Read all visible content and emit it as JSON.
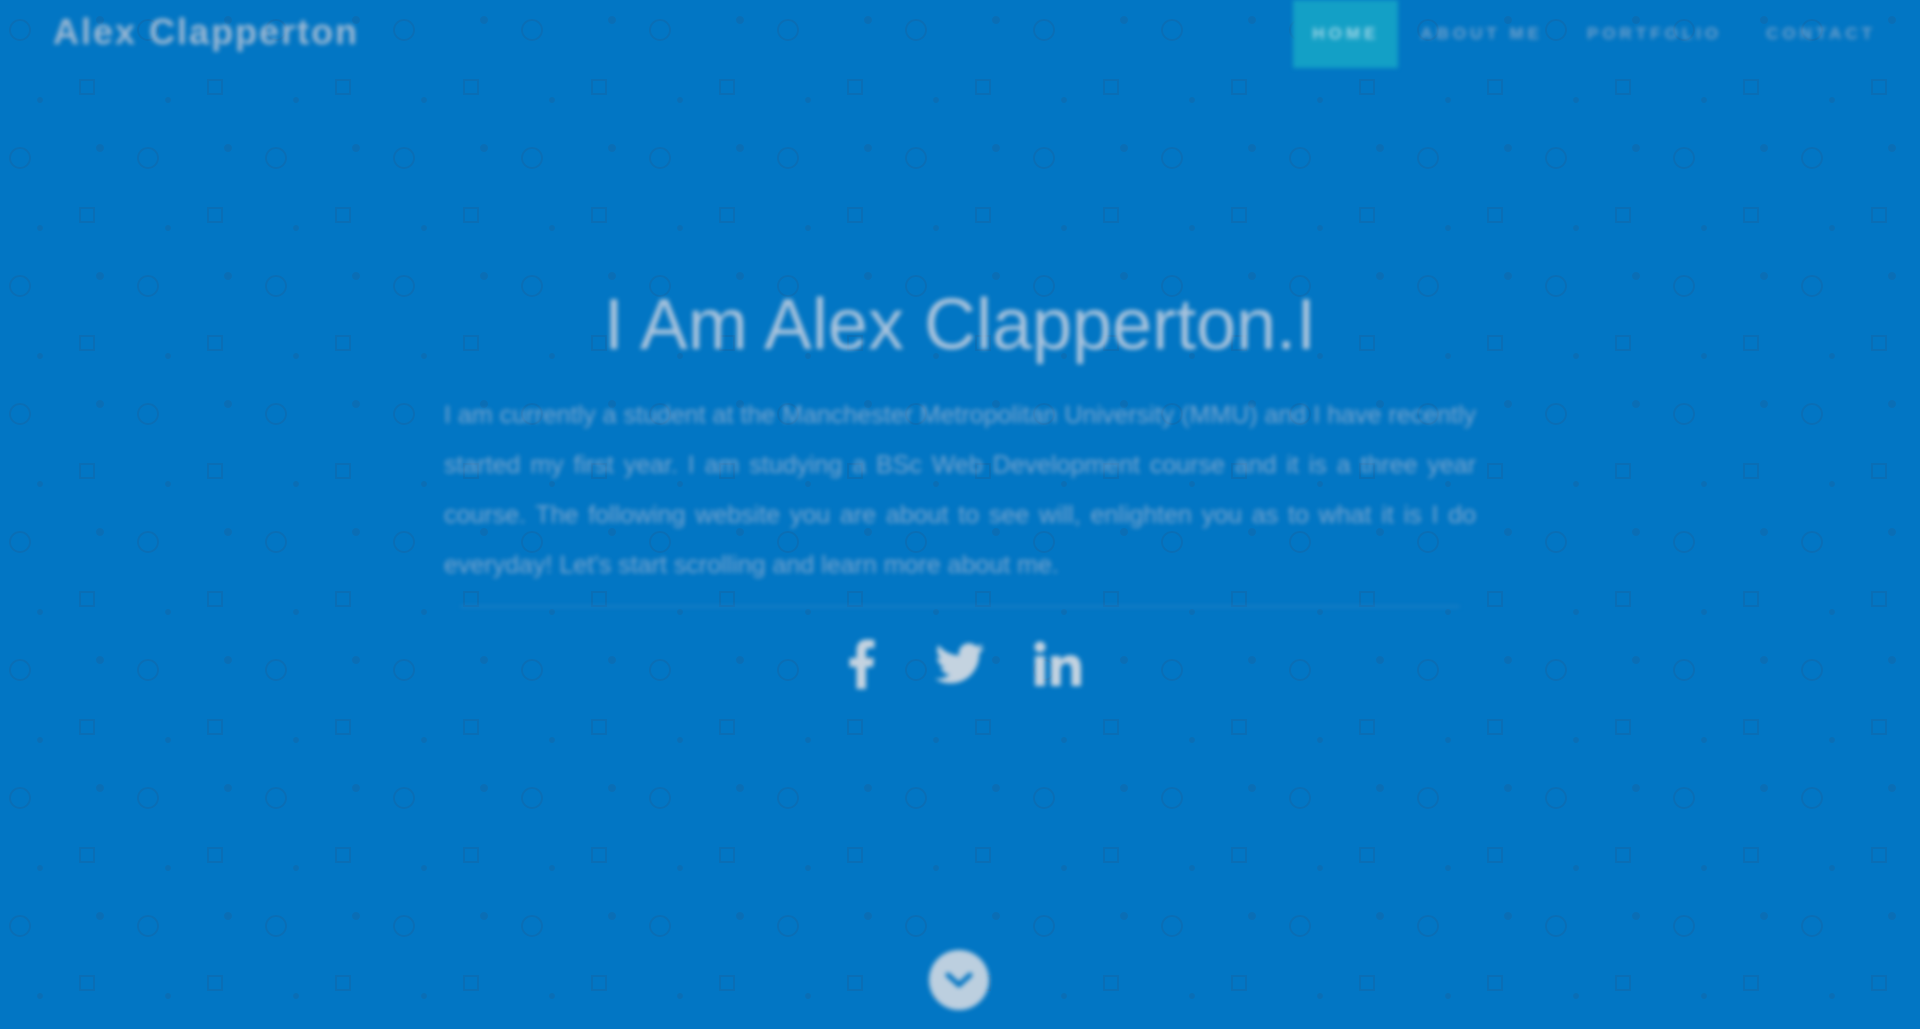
{
  "brand": "Alex Clapperton",
  "nav": {
    "items": [
      {
        "label": "HOME",
        "active": true
      },
      {
        "label": "ABOUT ME",
        "active": false
      },
      {
        "label": "PORTFOLIO",
        "active": false
      },
      {
        "label": "CONTACT",
        "active": false
      }
    ]
  },
  "hero": {
    "title": "I Am Alex Clapperton.I",
    "paragraph": "I am currently a student at the Manchester Metropolitan University (MMU) and I have recently started my first year. I am studying a BSc Web Development course and it is a three year course. The following website you are about to see will, enlighten you as to what it is I do everyday! Let's start scrolling and learn more about me."
  },
  "social": [
    {
      "icon": "facebook-icon"
    },
    {
      "icon": "twitter-icon"
    },
    {
      "icon": "linkedin-icon"
    }
  ],
  "scroll_icon": "chevron-down-icon",
  "colors": {
    "background": "#0276c4",
    "nav_active": "#13a0c6",
    "text": "#c8d6e2"
  }
}
